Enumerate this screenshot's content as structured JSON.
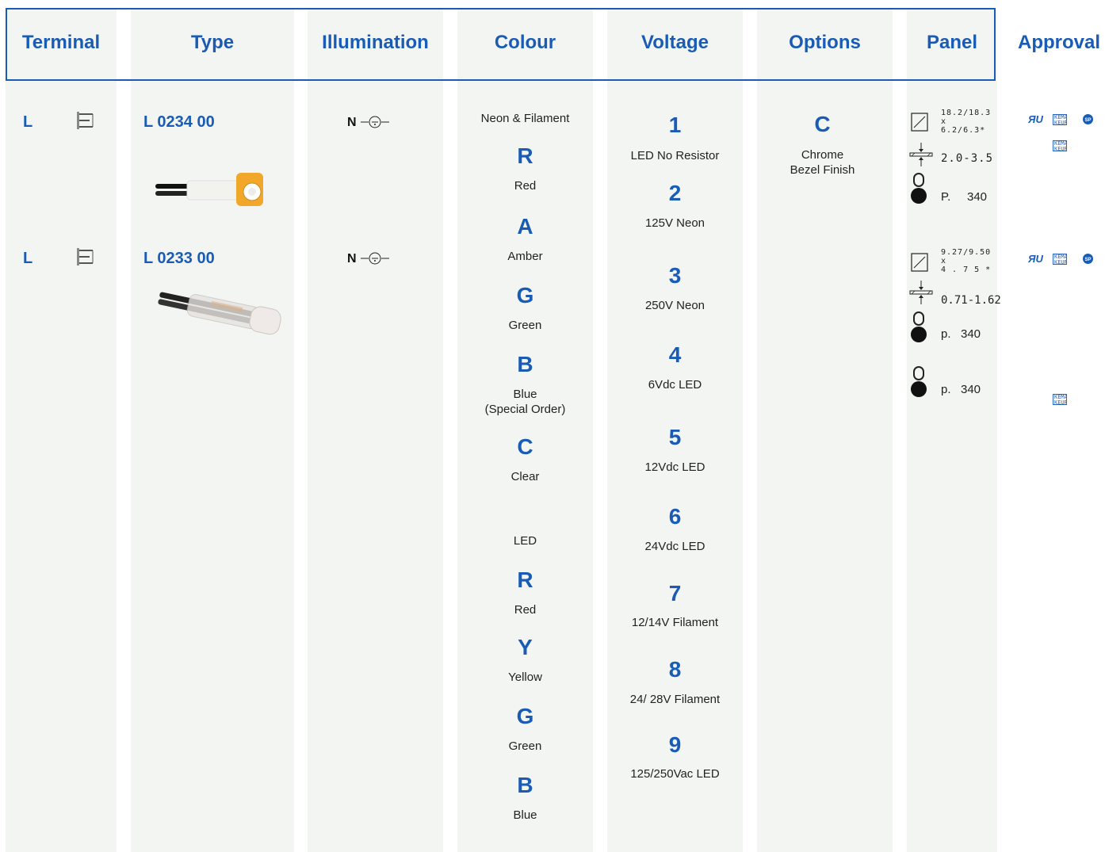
{
  "headers": {
    "terminal": "Terminal",
    "type": "Type",
    "illumination": "Illumination",
    "colour": "Colour",
    "voltage": "Voltage",
    "options": "Options",
    "panel": "Panel",
    "approval": "Approval"
  },
  "products": [
    {
      "terminal": "L",
      "type": "L 0234 00",
      "illumination": "N",
      "panel": {
        "cutout_line1": "18.2/18.3",
        "cutout_line2": "x",
        "cutout_line3": "6.2/6.3*",
        "thickness": "2.0-3.5",
        "page_prefix": "P.",
        "page": "340"
      }
    },
    {
      "terminal": "L",
      "type": "L 0233 00",
      "illumination": "N",
      "panel": {
        "cutout_line1": "9.27/9.50",
        "cutout_line2": "x",
        "cutout_line3": "4 . 7 5 *",
        "thickness": "0.71-1.62",
        "page_prefix": "p.",
        "page": "340",
        "page2_prefix": "p.",
        "page2": "340"
      }
    }
  ],
  "colour": {
    "group1_title": "Neon & Filament",
    "group1": [
      {
        "code": "R",
        "name": "Red"
      },
      {
        "code": "A",
        "name": "Amber"
      },
      {
        "code": "G",
        "name": "Green"
      },
      {
        "code": "B",
        "name": "Blue",
        "note": "(Special Order)"
      },
      {
        "code": "C",
        "name": "Clear"
      }
    ],
    "group2_title": "LED",
    "group2": [
      {
        "code": "R",
        "name": "Red"
      },
      {
        "code": "Y",
        "name": "Yellow"
      },
      {
        "code": "G",
        "name": "Green"
      },
      {
        "code": "B",
        "name": "Blue"
      }
    ]
  },
  "voltage": [
    {
      "code": "1",
      "label": "LED No Resistor"
    },
    {
      "code": "2",
      "label": "125V Neon"
    },
    {
      "code": "3",
      "label": "250V Neon"
    },
    {
      "code": "4",
      "label": "6Vdc LED"
    },
    {
      "code": "5",
      "label": "12Vdc LED"
    },
    {
      "code": "6",
      "label": "24Vdc LED"
    },
    {
      "code": "7",
      "label": "12/14V Filament"
    },
    {
      "code": "8",
      "label": "24/ 28V Filament"
    },
    {
      "code": "9",
      "label": "125/250Vac LED"
    }
  ],
  "options": {
    "code": "C",
    "line1": "Chrome",
    "line2": "Bezel Finish"
  },
  "approval": {
    "kema_label": "KEMA KEUR"
  },
  "icons": {
    "terminal": "terminal-pins-icon",
    "illumination": "neon-lamp-icon",
    "cutout": "panel-cutout-icon",
    "thickness": "panel-thickness-icon",
    "bulb": "bulb-page-ref-icon",
    "ur": "ur-recognized-icon",
    "csa": "csa-icon",
    "kema": "kema-keur-icon"
  },
  "colors": {
    "accent": "#1a5cb5",
    "column_bg": "#f3f5f2"
  }
}
